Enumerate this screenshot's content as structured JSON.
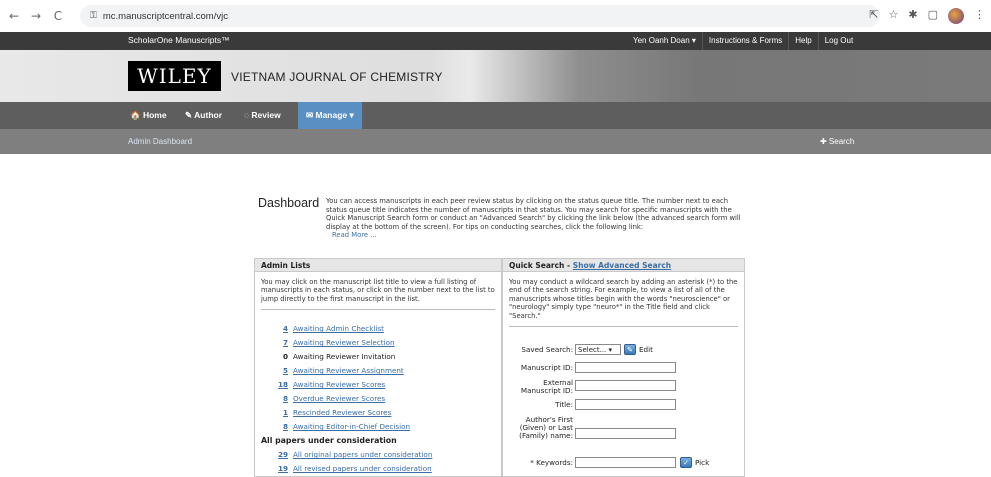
{
  "browser": {
    "url": "mc.manuscriptcentral.com/vjc",
    "back": "←",
    "forward": "→",
    "reload": "C",
    "lock": "🔒",
    "share_icon": "⇱",
    "star_icon": "☆",
    "ext_icon": "✱",
    "split_icon": "▢",
    "menu_icon": "⋮"
  },
  "topbar": {
    "brand": "ScholarOne Manuscripts™",
    "user": "Yen Oanh Doan ▾",
    "instructions": "Instructions & Forms",
    "help": "Help",
    "logout": "Log Out"
  },
  "header": {
    "logo": "WILEY",
    "journal": "VIETNAM JOURNAL OF CHEMISTRY"
  },
  "nav": {
    "home": "🏠 Home",
    "author": "✎ Author",
    "review": "◌ Review",
    "manage": "✉ Manage ▾"
  },
  "subbar": {
    "admin_dashboard": "Admin Dashboard",
    "search": "✚ Search"
  },
  "dashboard": {
    "title": "Dashboard",
    "text": "You can access manuscripts in each peer review status by clicking on the status queue title. The number next to each status queue title indicates the number of manuscripts in that status. You may search for specific manuscripts with the Quick Manuscript Search form or conduct an \"Advanced Search\" by clicking the link below (the advanced search form will display at the bottom of the screen). For tips on conducting searches, click the following link:",
    "read_more": "Read More ..."
  },
  "admin_lists": {
    "header": "Admin Lists",
    "desc": "You may click on the manuscript list title to view a full listing of manuscripts in each status, or click on the number next to the list to jump directly to the first manuscript in the list.",
    "queues": [
      {
        "num": "4",
        "label": "Awaiting Admin Checklist",
        "link": true
      },
      {
        "num": "7",
        "label": "Awaiting Reviewer Selection",
        "link": true
      },
      {
        "num": "0",
        "label": "Awaiting Reviewer Invitation",
        "link": false
      },
      {
        "num": "5",
        "label": "Awaiting Reviewer Assignment",
        "link": true
      },
      {
        "num": "18",
        "label": "Awaiting Reviewer Scores",
        "link": true
      },
      {
        "num": "8",
        "label": "Overdue Reviewer Scores",
        "link": true
      },
      {
        "num": "1",
        "label": "Rescinded Reviewer Scores",
        "link": true
      },
      {
        "num": "8",
        "label": "Awaiting Editor-in-Chief Decision",
        "link": true
      }
    ],
    "section2": "All papers under consideration",
    "queues2": [
      {
        "num": "29",
        "label": "All original papers under consideration",
        "link": true
      },
      {
        "num": "19",
        "label": "All revised papers under consideration",
        "link": true
      }
    ]
  },
  "quick_search": {
    "header": "Quick Search - ",
    "advanced_link": "Show Advanced Search",
    "desc": "You may conduct a wildcard search by adding an asterisk (*) to the end of the search string. For example, to view a list of all of the manuscripts whose titles begin with the words \"neuroscience\" or \"neurology\" simply type \"neuro*\" in the Title field and click \"Search.\"",
    "saved_search_label": "Saved Search:",
    "saved_search_value": "Select... ▾",
    "edit_label": "Edit",
    "manuscript_id_label": "Manuscript ID:",
    "external_id_label": "External Manuscript ID:",
    "title_label": "Title:",
    "author_label": "Author's First (Given) or Last (Family) name:",
    "keywords_label": "* Keywords:",
    "pick_label": "Pick"
  }
}
